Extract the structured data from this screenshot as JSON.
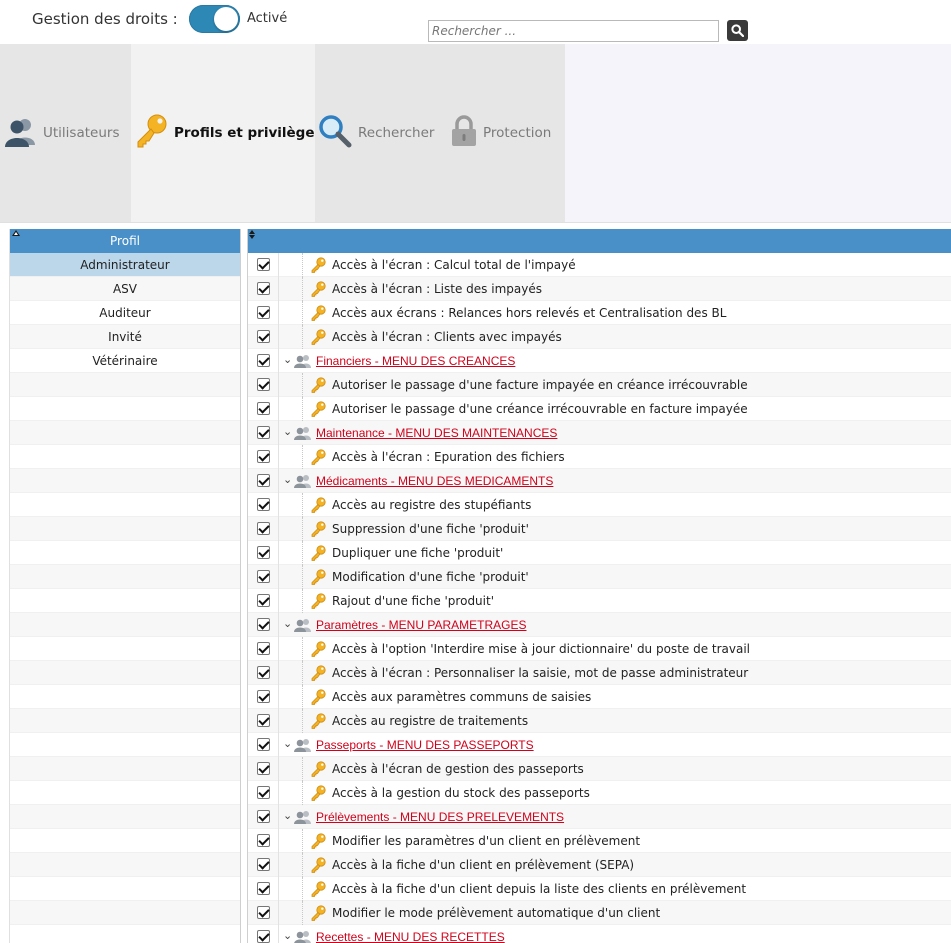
{
  "top": {
    "rights_label": "Gestion des droits :",
    "toggle_status": "Activé",
    "search_placeholder": "Rechercher ..."
  },
  "tabs": [
    {
      "label": "Utilisateurs",
      "icon": "users-icon",
      "active": false
    },
    {
      "label": "Profils et privilèges",
      "icon": "key-icon",
      "active": true
    },
    {
      "label": "Rechercher",
      "icon": "magnifier-icon",
      "active": false
    },
    {
      "label": "Protection",
      "icon": "lock-icon",
      "active": false
    }
  ],
  "profiles": {
    "header": "Profil",
    "items": [
      "Administrateur",
      "ASV",
      "Auditeur",
      "Invité",
      "Vétérinaire"
    ],
    "selected": "Administrateur"
  },
  "rights": {
    "rows": [
      {
        "type": "item",
        "label": "Accès à l'écran : Calcul total de l'impayé",
        "checked": true
      },
      {
        "type": "item",
        "label": "Accès à l'écran : Liste des impayés",
        "checked": true
      },
      {
        "type": "item",
        "label": "Accès aux écrans : Relances hors relevés et Centralisation des BL",
        "checked": true
      },
      {
        "type": "item",
        "label": "Accès à l'écran : Clients avec impayés",
        "checked": true
      },
      {
        "type": "group",
        "label": "Financiers - MENU DES CREANCES",
        "checked": true
      },
      {
        "type": "item",
        "label": "Autoriser le passage d'une facture impayée en créance irrécouvrable",
        "checked": true
      },
      {
        "type": "item",
        "label": "Autoriser le passage d'une créance irrécouvrable en facture impayée",
        "checked": true
      },
      {
        "type": "group",
        "label": "Maintenance - MENU DES MAINTENANCES",
        "checked": true
      },
      {
        "type": "item",
        "label": "Accès à l'écran : Epuration des fichiers",
        "checked": true
      },
      {
        "type": "group",
        "label": "Médicaments - MENU DES MEDICAMENTS",
        "checked": true
      },
      {
        "type": "item",
        "label": "Accès au registre des stupéfiants",
        "checked": true
      },
      {
        "type": "item",
        "label": "Suppression d'une fiche 'produit'",
        "checked": true
      },
      {
        "type": "item",
        "label": "Dupliquer une fiche 'produit'",
        "checked": true
      },
      {
        "type": "item",
        "label": "Modification d'une fiche 'produit'",
        "checked": true
      },
      {
        "type": "item",
        "label": "Rajout d'une fiche 'produit'",
        "checked": true
      },
      {
        "type": "group",
        "label": "Paramètres - MENU PARAMETRAGES",
        "checked": true
      },
      {
        "type": "item",
        "label": "Accès à l'option 'Interdire mise à jour dictionnaire' du poste de travail",
        "checked": true
      },
      {
        "type": "item",
        "label": "Accès à l'écran : Personnaliser la saisie, mot de passe administrateur",
        "checked": true
      },
      {
        "type": "item",
        "label": "Accès aux paramètres communs de saisies",
        "checked": true
      },
      {
        "type": "item",
        "label": "Accès au registre de traitements",
        "checked": true
      },
      {
        "type": "group",
        "label": "Passeports - MENU DES PASSEPORTS",
        "checked": true
      },
      {
        "type": "item",
        "label": "Accès à l'écran de gestion des passeports",
        "checked": true
      },
      {
        "type": "item",
        "label": "Accès à la gestion du stock des passeports",
        "checked": true
      },
      {
        "type": "group",
        "label": "Prélèvements - MENU DES PRELEVEMENTS",
        "checked": true
      },
      {
        "type": "item",
        "label": "Modifier les paramètres d'un client en prélèvement",
        "checked": true
      },
      {
        "type": "item",
        "label": "Accès à la fiche d'un client en prélèvement (SEPA)",
        "checked": true
      },
      {
        "type": "item",
        "label": "Accès à la fiche d'un client depuis la liste des clients en prélèvement",
        "checked": true
      },
      {
        "type": "item",
        "label": "Modifier le mode prélèvement automatique d'un client",
        "checked": true
      },
      {
        "type": "group",
        "label": "Recettes - MENU DES RECETTES",
        "checked": true
      }
    ]
  },
  "colors": {
    "accent": "#4a90c8",
    "toggle": "#2e88b5",
    "group_link": "#d0021b",
    "selected_row": "#bcd6ea"
  }
}
